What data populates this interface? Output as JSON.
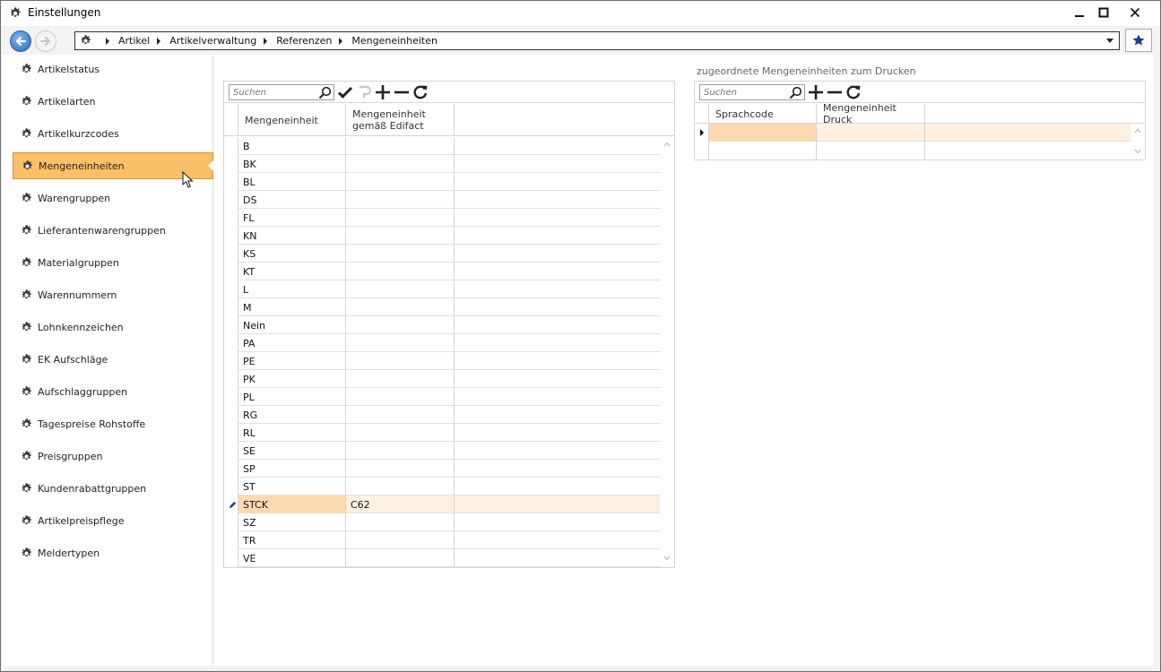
{
  "window": {
    "title": "Einstellungen"
  },
  "breadcrumb": [
    "Artikel",
    "Artikelverwaltung",
    "Referenzen",
    "Mengeneinheiten"
  ],
  "sidebar": {
    "items": [
      {
        "label": "Artikelstatus"
      },
      {
        "label": "Artikelarten"
      },
      {
        "label": "Artikelkurzcodes"
      },
      {
        "label": "Mengeneinheiten",
        "active": true
      },
      {
        "label": "Warengruppen"
      },
      {
        "label": "Lieferantenwarengruppen"
      },
      {
        "label": "Materialgruppen"
      },
      {
        "label": "Warennummern"
      },
      {
        "label": "Lohnkennzeichen"
      },
      {
        "label": "EK Aufschläge"
      },
      {
        "label": "Aufschlaggruppen"
      },
      {
        "label": "Tagespreise Rohstoffe"
      },
      {
        "label": "Preisgruppen"
      },
      {
        "label": "Kundenrabattgruppen"
      },
      {
        "label": "Artikelpreispflege"
      },
      {
        "label": "Meldertypen"
      }
    ]
  },
  "left_grid": {
    "search_placeholder": "Suchen",
    "columns": [
      "Mengeneinheit",
      "Mengeneinheit gemäß Edifact",
      ""
    ],
    "rows": [
      [
        "B",
        ""
      ],
      [
        "BK",
        ""
      ],
      [
        "BL",
        ""
      ],
      [
        "DS",
        ""
      ],
      [
        "FL",
        ""
      ],
      [
        "KN",
        ""
      ],
      [
        "KS",
        ""
      ],
      [
        "KT",
        ""
      ],
      [
        "L",
        ""
      ],
      [
        "M",
        ""
      ],
      [
        "Nein",
        ""
      ],
      [
        "PA",
        ""
      ],
      [
        "PE",
        ""
      ],
      [
        "PK",
        ""
      ],
      [
        "PL",
        ""
      ],
      [
        "RG",
        ""
      ],
      [
        "RL",
        ""
      ],
      [
        "SE",
        ""
      ],
      [
        "SP",
        ""
      ],
      [
        "ST",
        ""
      ],
      [
        "STCK",
        "C62"
      ],
      [
        "SZ",
        ""
      ],
      [
        "TR",
        ""
      ],
      [
        "VE",
        ""
      ]
    ],
    "selected_row": 20
  },
  "right_panel": {
    "title": "zugeordnete Mengeneinheiten zum Drucken",
    "search_placeholder": "Suchen",
    "columns": [
      "Sprachcode",
      "Mengeneinheit Druck",
      ""
    ],
    "rows": [
      [
        "",
        ""
      ],
      [
        "",
        ""
      ]
    ]
  },
  "colors": {
    "accent": "#fbbf68",
    "selection": "#fdd9b0",
    "selection_row": "#fdf0e1"
  }
}
